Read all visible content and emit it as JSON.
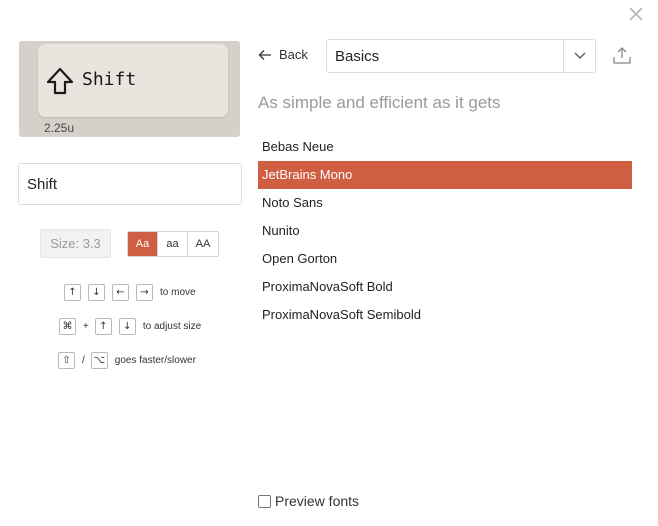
{
  "keycap": {
    "label": "Shift",
    "size": "2.25u",
    "icon": "shift-arrow-icon"
  },
  "legend_input": {
    "value": "Shift"
  },
  "controls": {
    "size_label": "Size: 3.3",
    "case_options": [
      "Aa",
      "aa",
      "AA"
    ],
    "case_selected": "Aa"
  },
  "help": {
    "move_text": "to move",
    "move_keys": [
      "↑",
      "↓",
      "←",
      "→"
    ],
    "resize_keys": [
      "⌘",
      "↑",
      "↓"
    ],
    "resize_plus": "+",
    "resize_text": "to adjust size",
    "speed_keys": [
      "⇧",
      "⌥"
    ],
    "speed_sep": "/",
    "speed_text": "goes faster/slower"
  },
  "header": {
    "back_label": "Back",
    "category_value": "Basics"
  },
  "subtitle": "As simple and efficient as it gets",
  "fonts": [
    {
      "name": "Bebas Neue"
    },
    {
      "name": "JetBrains Mono"
    },
    {
      "name": "Noto Sans"
    },
    {
      "name": "Nunito"
    },
    {
      "name": "Open Gorton"
    },
    {
      "name": "ProximaNovaSoft Bold"
    },
    {
      "name": "ProximaNovaSoft Semibold"
    }
  ],
  "selected_font": "JetBrains Mono",
  "preview_label": "Preview fonts",
  "colors": {
    "accent": "#cf5e42",
    "keycap_base": "#d4d0ca",
    "keycap_top": "#e8e4de"
  }
}
